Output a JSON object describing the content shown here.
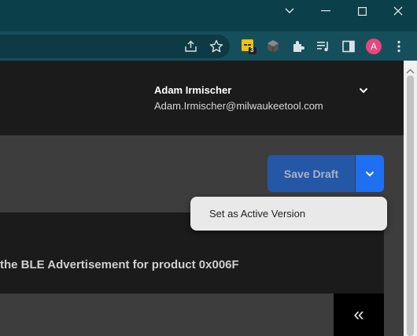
{
  "browser": {
    "window_controls": [
      "chevron-down",
      "minimize",
      "maximize",
      "close"
    ],
    "extension_badge": "3",
    "profile_initial": "A",
    "profile_color": "#e8467c"
  },
  "header": {
    "user_name": "Adam Irmischer",
    "user_email": "Adam.Irmischer@milwaukeetool.com"
  },
  "actions": {
    "save_draft_label": "Save Draft",
    "dropdown_items": [
      {
        "label": "Set as Active Version"
      }
    ]
  },
  "content": {
    "description": "the BLE Advertisement for product 0x006F"
  },
  "sidebar": {
    "collapse_label": "«"
  },
  "colors": {
    "save_button": "#2557a7",
    "split_button": "#1f6ff2",
    "titlebar": "#0b3f4a",
    "toolbar": "#164f5c"
  }
}
